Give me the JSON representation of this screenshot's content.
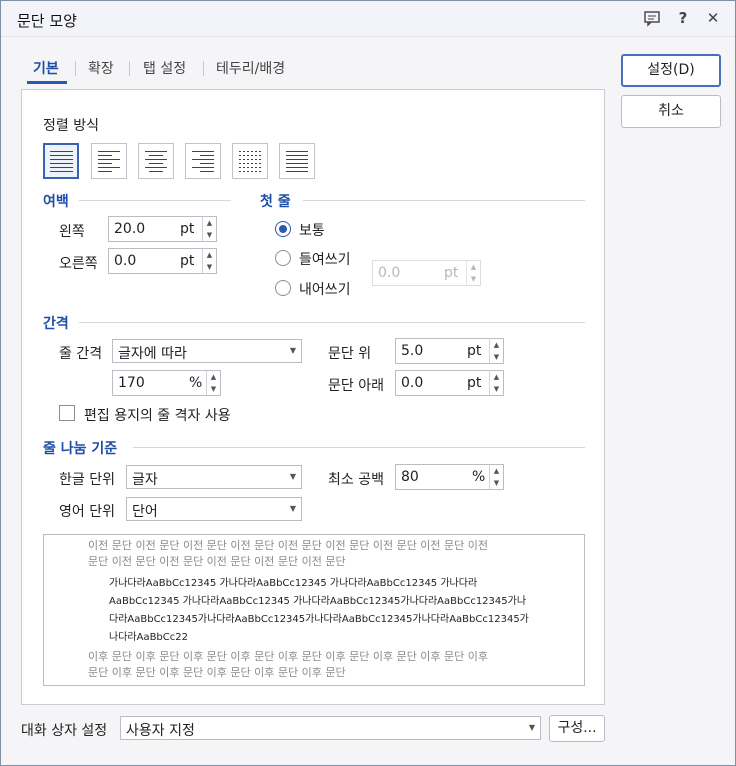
{
  "window": {
    "title": "문단 모양"
  },
  "titlebar_icons": [
    "comment-icon",
    "help-icon",
    "close-icon"
  ],
  "titlebar_text": {
    "help": "?",
    "close": "✕"
  },
  "tabs": [
    {
      "label": "기본",
      "active": true
    },
    {
      "label": "확장"
    },
    {
      "label": "탭 설정"
    },
    {
      "label": "테두리/배경"
    }
  ],
  "buttons": {
    "ok": "설정(D)",
    "cancel": "취소",
    "config": "구성..."
  },
  "alignment": {
    "label": "정렬 방식",
    "options": [
      "justify",
      "left",
      "center",
      "right",
      "distribute",
      "divide"
    ],
    "selected": "justify"
  },
  "margin": {
    "title": "여백",
    "left": {
      "label": "왼쪽",
      "value": "20.0",
      "unit": "pt"
    },
    "right": {
      "label": "오른쪽",
      "value": "0.0",
      "unit": "pt"
    }
  },
  "first_line": {
    "title": "첫 줄",
    "options": [
      "보통",
      "들여쓰기",
      "내어쓰기"
    ],
    "selected": "보통",
    "indent": {
      "value": "0.0",
      "unit": "pt"
    }
  },
  "spacing": {
    "title": "간격",
    "line_label": "줄 간격",
    "line_mode": "글자에 따라",
    "line_value": "170",
    "line_unit": "%",
    "above": {
      "label": "문단 위",
      "value": "5.0",
      "unit": "pt"
    },
    "below": {
      "label": "문단 아래",
      "value": "0.0",
      "unit": "pt"
    },
    "grid_checkbox": "편집 용지의 줄 격자 사용"
  },
  "wrap": {
    "title": "줄 나눔 기준",
    "korean": {
      "label": "한글 단위",
      "value": "글자"
    },
    "english": {
      "label": "영어 단위",
      "value": "단어"
    },
    "min_space": {
      "label": "최소 공백",
      "value": "80",
      "unit": "%"
    }
  },
  "preview": {
    "before": [
      "이전 문단 이전 문단 이전 문단 이전 문단 이전 문단 이전 문단 이전 문단 이전 문단 이전",
      "문단 이전 문단 이전 문단 이전 문단 이전 문단 이전 문단"
    ],
    "main": [
      "가나다라AaBbCc12345     가나다라AaBbCc12345     가나다라AaBbCc12345     가나다라",
      "AaBbCc12345  가나다라AaBbCc12345  가나다라AaBbCc12345가나다라AaBbCc12345가나",
      "다라AaBbCc12345가나다라AaBbCc12345가나다라AaBbCc12345가나다라AaBbCc12345가",
      "나다라AaBbCc22"
    ],
    "after": [
      "이후 문단 이후 문단 이후 문단 이후 문단 이후 문단 이후 문단 이후 문단 이후 문단 이후",
      "문단 이후 문단 이후 문단 이후 문단 이후 문단 이후 문단"
    ]
  },
  "footer": {
    "label": "대화 상자 설정",
    "value": "사용자 지정"
  }
}
